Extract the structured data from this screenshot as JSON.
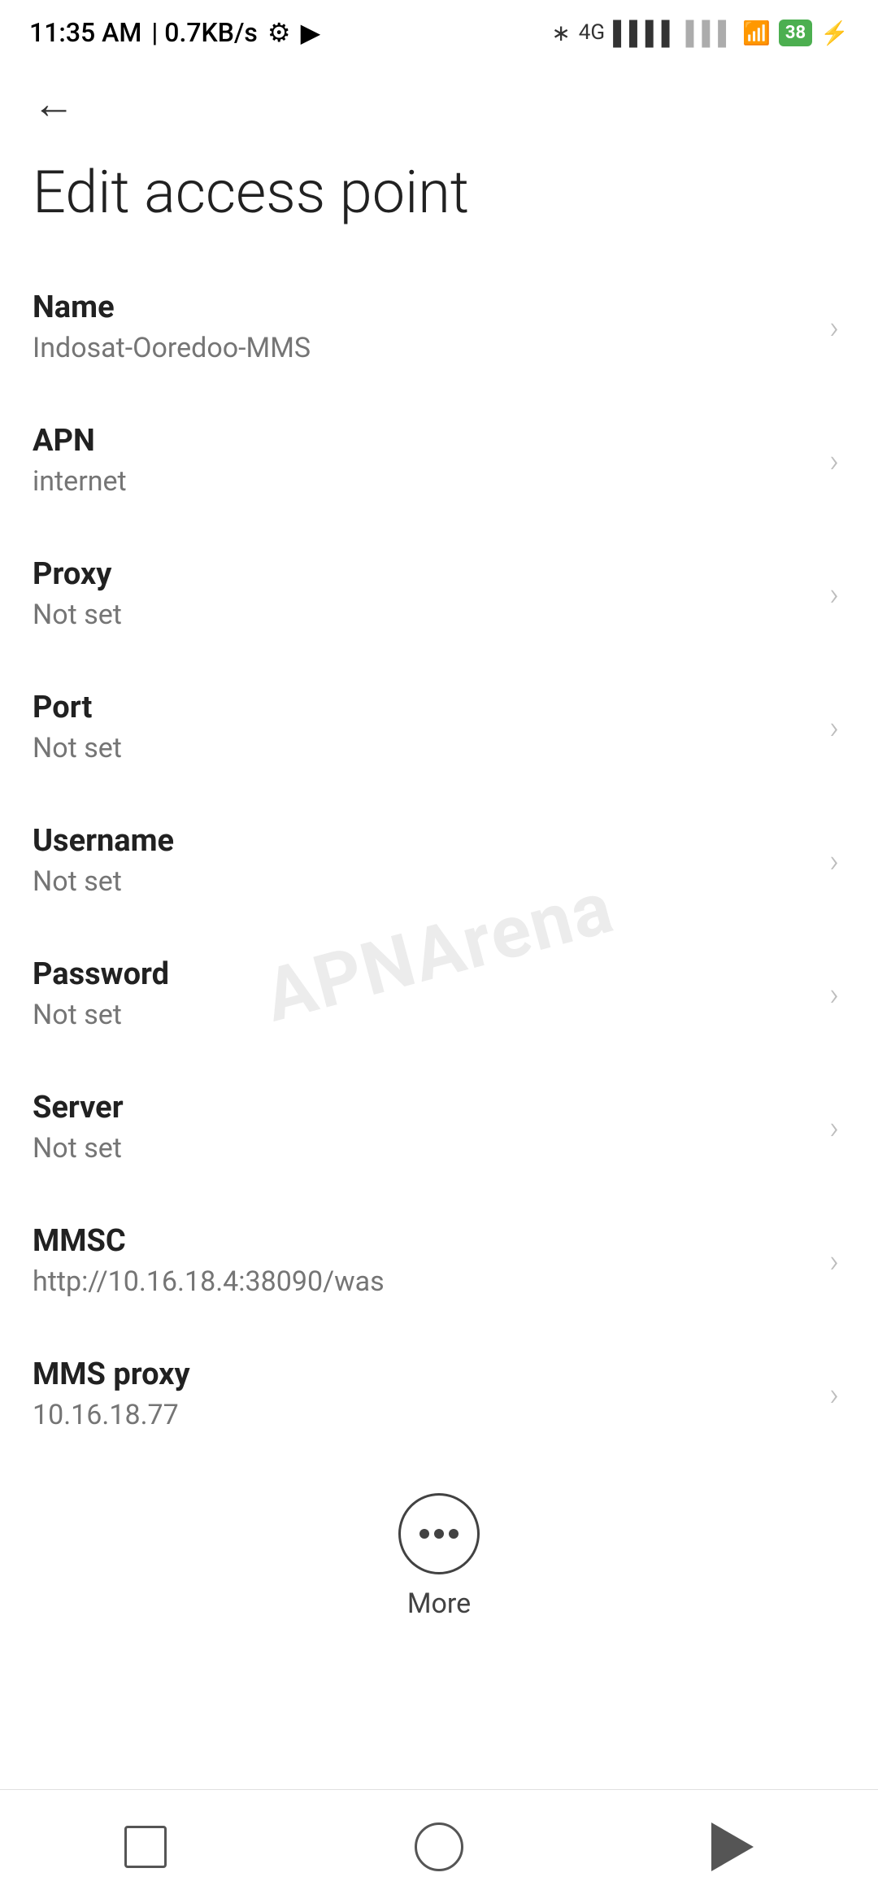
{
  "statusBar": {
    "time": "11:35 AM",
    "speed": "0.7KB/s",
    "battery": "38"
  },
  "page": {
    "title": "Edit access point",
    "backLabel": "←"
  },
  "settings": [
    {
      "label": "Name",
      "value": "Indosat-Ooredoo-MMS"
    },
    {
      "label": "APN",
      "value": "internet"
    },
    {
      "label": "Proxy",
      "value": "Not set"
    },
    {
      "label": "Port",
      "value": "Not set"
    },
    {
      "label": "Username",
      "value": "Not set"
    },
    {
      "label": "Password",
      "value": "Not set"
    },
    {
      "label": "Server",
      "value": "Not set"
    },
    {
      "label": "MMSC",
      "value": "http://10.16.18.4:38090/was"
    },
    {
      "label": "MMS proxy",
      "value": "10.16.18.77"
    }
  ],
  "watermark": "APNArena",
  "more": {
    "label": "More"
  }
}
